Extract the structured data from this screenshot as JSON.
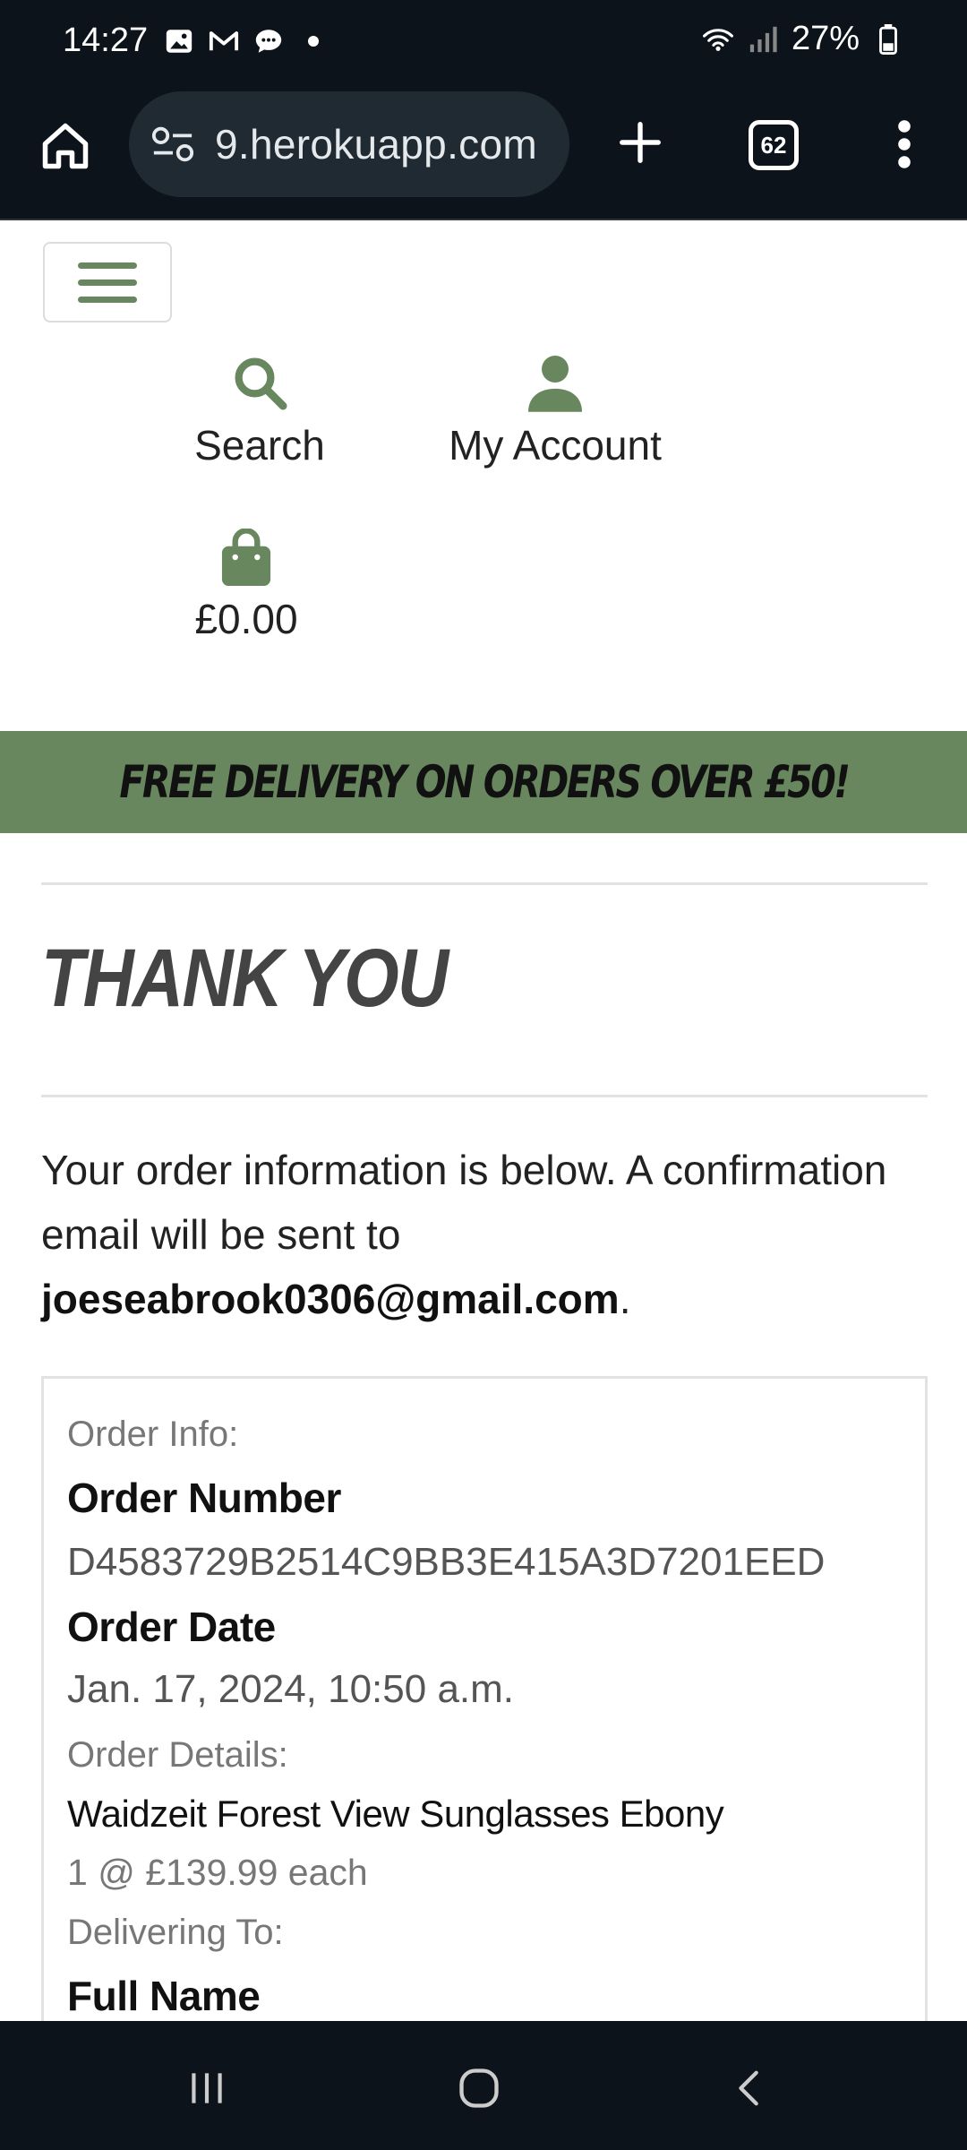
{
  "status_bar": {
    "time": "14:27",
    "battery": "27%"
  },
  "browser": {
    "url": "9.herokuapp.com",
    "tab_count": "62"
  },
  "nav": {
    "search_label": "Search",
    "account_label": "My Account",
    "bag_total": "£0.00"
  },
  "promo": {
    "text": "FREE DELIVERY ON ORDERS OVER £50!"
  },
  "page": {
    "title": "THANK YOU",
    "intro_text": "Your order information is below. A confirmation email will be sent to ",
    "email": "joeseabrook0306@gmail.com",
    "intro_end": "."
  },
  "order": {
    "info_heading": "Order Info:",
    "number_label": "Order Number",
    "number_value": "D4583729B2514C9BB3E415A3D7201EED",
    "date_label": "Order Date",
    "date_value": "Jan. 17, 2024, 10:50 a.m.",
    "details_heading": "Order Details:",
    "item_name": "Waidzeit Forest View Sunglasses Ebony",
    "item_qty_price": "1 @ £139.99 each",
    "delivering_heading": "Delivering To:",
    "full_name_label": "Full Name"
  },
  "colors": {
    "brand_green": "#68875f",
    "dark_bar": "#0d131a"
  }
}
